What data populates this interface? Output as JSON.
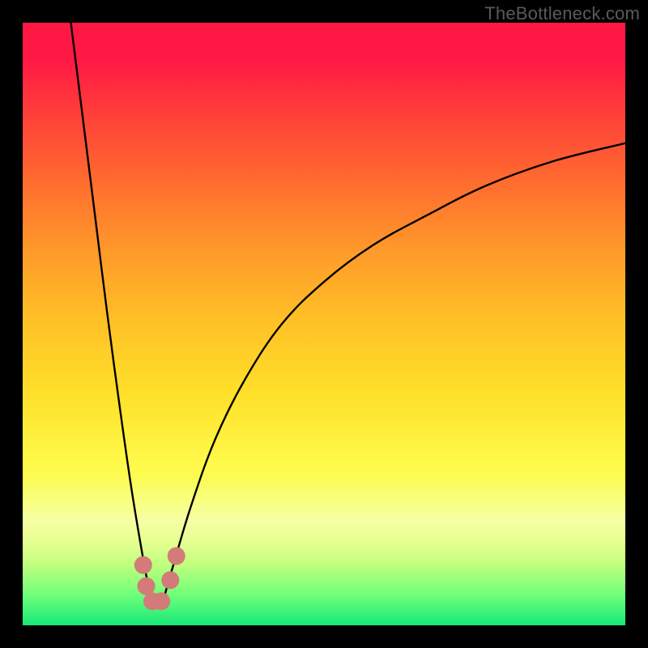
{
  "watermark": "TheBottleneck.com",
  "colors": {
    "gradient_top": "#ff1844",
    "gradient_mid": "#ffe12a",
    "gradient_bottom": "#16e878",
    "curve": "#000000",
    "marker": "#d37b78",
    "background": "#000000"
  },
  "chart_data": {
    "type": "line",
    "title": "",
    "xlabel": "",
    "ylabel": "",
    "xlim": [
      0,
      100
    ],
    "ylim": [
      0,
      100
    ],
    "notes": "Two curves forming a V/notch near x≈22; left curve falls steeply from y=100 to ~0, right curve rises asymptotically from near 0 toward ~80 at x=100. Marker cluster sits at the trough (~x 20–25, y 4–12).",
    "series": [
      {
        "name": "left-curve",
        "x": [
          8,
          10,
          12,
          14,
          16,
          18,
          20,
          21,
          22
        ],
        "values": [
          100,
          84,
          68,
          52,
          37,
          23,
          11,
          6,
          3
        ]
      },
      {
        "name": "right-curve",
        "x": [
          23,
          25,
          28,
          32,
          37,
          43,
          50,
          58,
          67,
          77,
          88,
          100
        ],
        "values": [
          3,
          10,
          20,
          31,
          41,
          50,
          57,
          63,
          68,
          73,
          77,
          80
        ]
      }
    ],
    "markers": [
      {
        "x": 20.0,
        "y": 10.0
      },
      {
        "x": 20.5,
        "y": 6.5
      },
      {
        "x": 21.5,
        "y": 4.0
      },
      {
        "x": 23.0,
        "y": 4.0
      },
      {
        "x": 24.5,
        "y": 7.5
      },
      {
        "x": 25.5,
        "y": 11.5
      }
    ]
  }
}
